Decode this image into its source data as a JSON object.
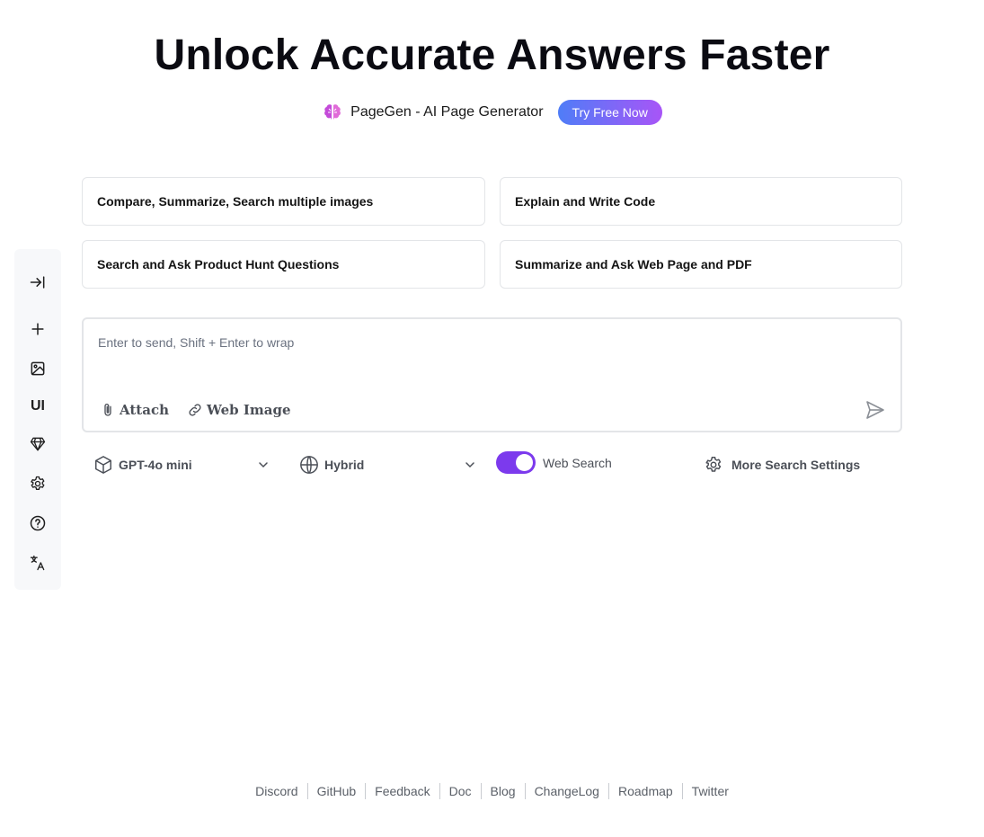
{
  "hero": {
    "title": "Unlock Accurate Answers Faster"
  },
  "promo": {
    "text": "PageGen - AI Page Generator",
    "button": "Try Free Now",
    "icon": "brain-icon"
  },
  "sidebar": {
    "items": [
      {
        "icon": "collapse-sidebar-icon"
      },
      {
        "icon": "plus-icon"
      },
      {
        "icon": "image-icon"
      },
      {
        "label": "UI"
      },
      {
        "icon": "diamond-icon"
      },
      {
        "icon": "gear-icon"
      },
      {
        "icon": "help-icon"
      },
      {
        "icon": "translate-icon"
      }
    ]
  },
  "suggestions": [
    "Compare, Summarize, Search multiple images",
    "Explain and Write Code",
    "Search and Ask Product Hunt Questions",
    "Summarize and Ask Web Page and PDF"
  ],
  "input": {
    "placeholder": "Enter to send, Shift + Enter to wrap",
    "attach": "Attach",
    "web_image": "Web Image"
  },
  "controls": {
    "model": "GPT-4o mini",
    "mode": "Hybrid",
    "web_search_label": "Web Search",
    "web_search_on": true,
    "more_settings": "More Search Settings"
  },
  "footer": {
    "links": [
      "Discord",
      "GitHub",
      "Feedback",
      "Doc",
      "Blog",
      "ChangeLog",
      "Roadmap",
      "Twitter"
    ]
  },
  "colors": {
    "accent": "#7c3aed",
    "promo_gradient_start": "#4f7df7",
    "promo_gradient_end": "#a855f7"
  }
}
